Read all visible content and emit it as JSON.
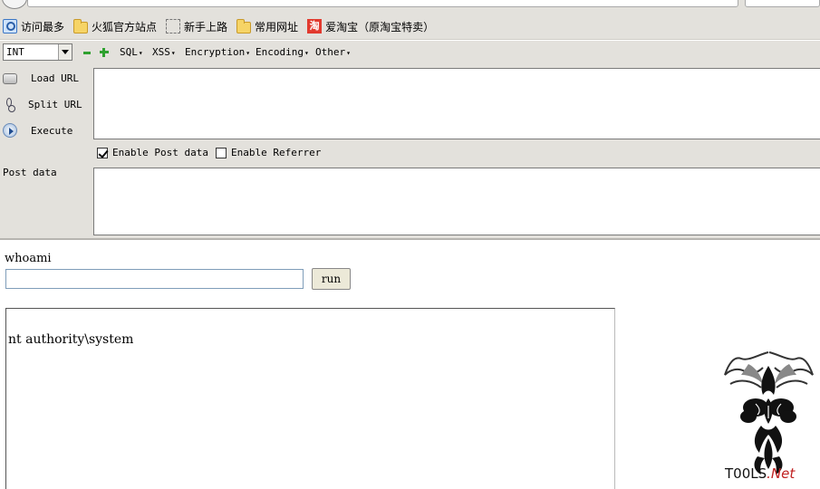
{
  "bookmarks": [
    {
      "label": "访问最多",
      "icon": "most-visited-icon"
    },
    {
      "label": "火狐官方站点",
      "icon": "folder-icon"
    },
    {
      "label": "新手上路",
      "icon": "dashed-page-icon"
    },
    {
      "label": "常用网址",
      "icon": "folder-icon"
    },
    {
      "label": "爱淘宝（原淘宝特卖）",
      "icon": "taobao-icon"
    }
  ],
  "hackbar": {
    "type_select": "INT",
    "menus": [
      "SQL",
      "XSS",
      "Encryption",
      "Encoding",
      "Other"
    ],
    "load_url": "Load URL",
    "split_url": "Split URL",
    "execute": "Execute",
    "url_value": "",
    "enable_post": "Enable Post data",
    "enable_post_checked": true,
    "enable_referrer": "Enable Referrer",
    "enable_referrer_checked": false,
    "post_label": "Post data",
    "post_value": ""
  },
  "page": {
    "command_label": "whoami",
    "command_value": "",
    "run_label": "run",
    "output": "nt authority\\system"
  },
  "logo": {
    "text_main": "T00LS",
    "text_suffix": ".Net"
  },
  "colors": {
    "chrome_bg": "#e3e1dc",
    "green_icon": "#2fa12f",
    "taobao_red": "#e23a2e",
    "logo_red": "#c02020"
  }
}
